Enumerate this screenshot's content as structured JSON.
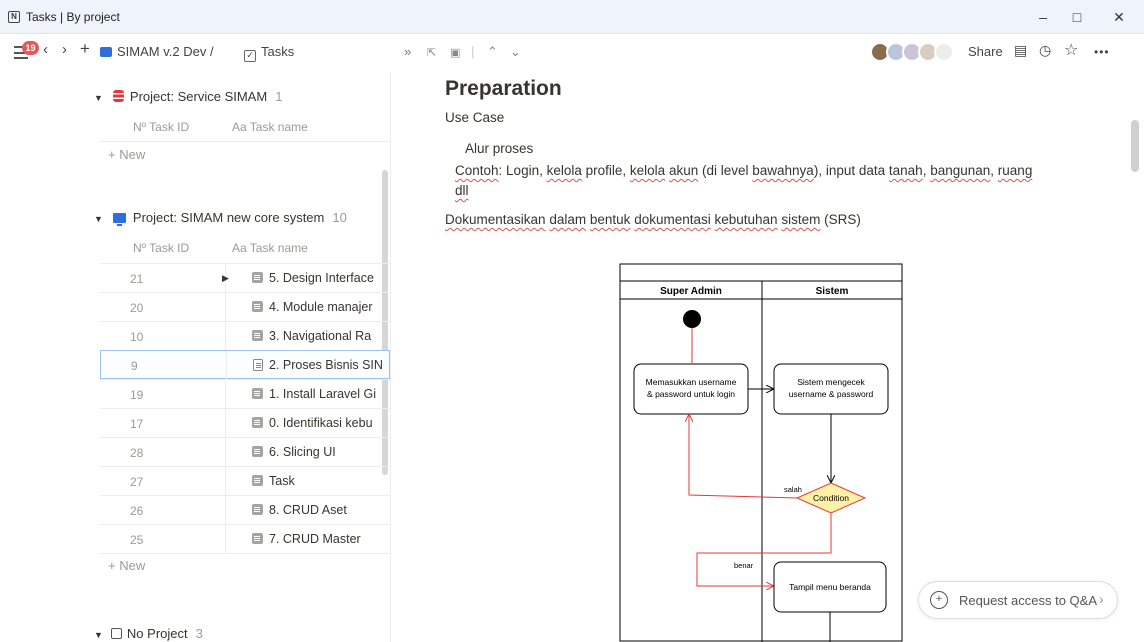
{
  "window": {
    "title": "Tasks | By project",
    "app_icon": "N"
  },
  "toolbar": {
    "notification_count": "19",
    "workspace": "SIMAM v.2 Dev /",
    "page": "Tasks",
    "share_label": "Share",
    "more_label": "•••"
  },
  "groups": [
    {
      "title": "Project: Service SIMAM",
      "count": "1"
    },
    {
      "title": "Project: SIMAM new core system",
      "count": "10"
    },
    {
      "title": "No Project",
      "count": "3"
    }
  ],
  "columns": {
    "task_id": "Nº Task ID",
    "task_name": "Aa Task name"
  },
  "new_label": "+ New",
  "rows": [
    {
      "id": "21",
      "name": "5. Design Interface"
    },
    {
      "id": "20",
      "name": "4. Module manajer"
    },
    {
      "id": "10",
      "name": "3. Navigational Ra"
    },
    {
      "id": "9",
      "name": "2. Proses Bisnis SIN"
    },
    {
      "id": "19",
      "name": "1. Install Laravel Gi"
    },
    {
      "id": "17",
      "name": "0. Identifikasi kebu"
    },
    {
      "id": "28",
      "name": "6. Slicing UI"
    },
    {
      "id": "27",
      "name": "Task"
    },
    {
      "id": "26",
      "name": "8. CRUD Aset"
    },
    {
      "id": "25",
      "name": "7. CRUD Master"
    }
  ],
  "doc": {
    "heading": "Preparation",
    "use_case": "Use Case",
    "alur": "Alur proses",
    "contoh_label": "Contoh",
    "contoh_1": ": Login, ",
    "contoh_kelola1": "kelola",
    "contoh_2": " profile, ",
    "contoh_kelola2": "kelola",
    "contoh_3": " ",
    "contoh_akun": "akun",
    "contoh_4": " (di level ",
    "contoh_bawahnya": "bawahnya",
    "contoh_5": "), input data ",
    "contoh_tanah": "tanah",
    "contoh_6": ", ",
    "contoh_bangunan": "bangunan",
    "contoh_7": ", ",
    "contoh_ruang": "ruang",
    "dll": "dll",
    "dok_words": [
      "Dokumentasikan",
      "dalam",
      "bentuk",
      "dokumentasi",
      "kebutuhan",
      "sistem"
    ],
    "dok_tail": "(SRS)"
  },
  "diagram": {
    "lane_left": "Super Admin",
    "lane_right": "Sistem",
    "box1_line1": "Memasukkan username",
    "box1_line2": "& password untuk login",
    "box2_line1": "Sistem mengecek",
    "box2_line2": "username & password",
    "condition": "Condition",
    "salah": "salah",
    "benar": "benar",
    "box3": "Tampil menu beranda"
  },
  "qa": {
    "label": "Request access to Q&A",
    "chevron": "›"
  }
}
